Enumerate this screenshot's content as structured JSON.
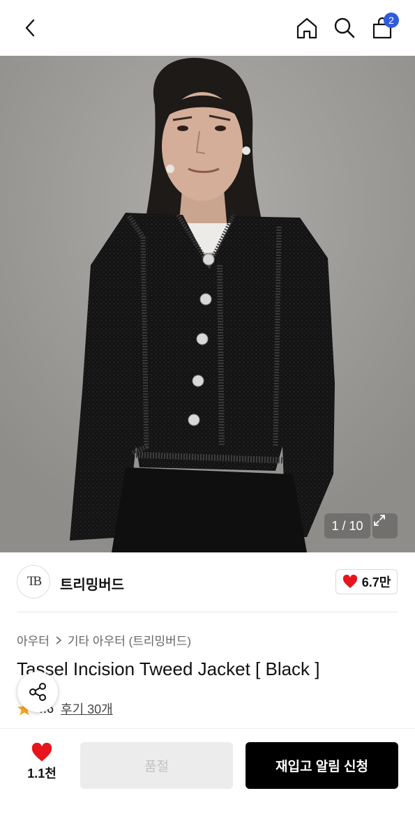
{
  "header": {
    "cart_count": "2"
  },
  "hero": {
    "pager": "1 / 10"
  },
  "brand": {
    "logo_text": "TB",
    "name": "트리밍버드",
    "like_count": "6.7만"
  },
  "breadcrumb": {
    "level1": "아우터",
    "separator": ">",
    "level2": "기타 아우터 (트리밍버드)"
  },
  "product": {
    "title": "Tassel Incision Tweed Jacket [ Black ]",
    "rating": "4.6",
    "reviews": "후기 30개"
  },
  "bottom_bar": {
    "wish_count": "1.1천",
    "soldout_label": "품절",
    "restock_label": "재입고 알림 신청"
  },
  "colors": {
    "accent_badge": "#2f5bdc",
    "heart": "#e8141b",
    "star": "#f5a623",
    "primary_button": "#000000"
  }
}
